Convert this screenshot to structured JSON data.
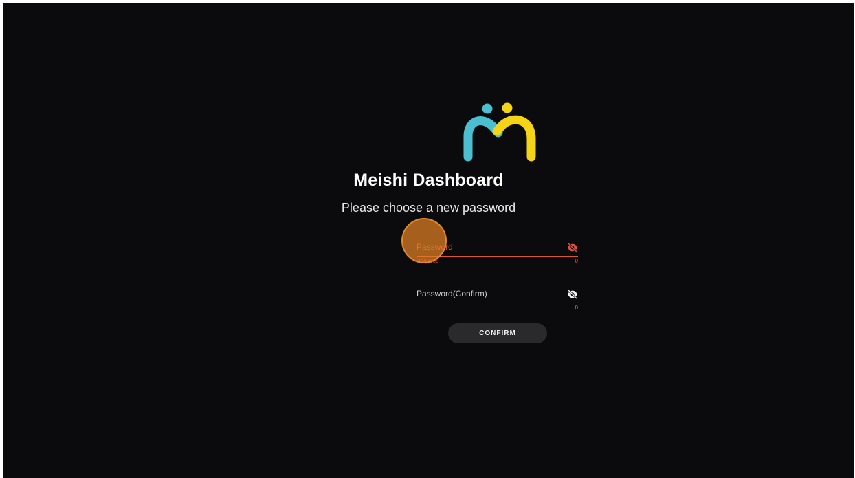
{
  "app": {
    "title": "Meishi Dashboard",
    "subtitle": "Please choose a new password"
  },
  "form": {
    "password": {
      "label": "Password",
      "helper": "Required",
      "counter": "0",
      "state": "error",
      "visibility_icon": "eye-off-icon"
    },
    "password_confirm": {
      "label": "Password(Confirm)",
      "counter": "0",
      "visibility_icon": "eye-off-icon"
    },
    "confirm_label": "CONFIRM"
  },
  "colors": {
    "background": "#0b0b0d",
    "error": "#e0523f",
    "logo_cyan": "#4bbfcf",
    "logo_yellow": "#f5d316",
    "button": "#2a2a2c",
    "touch_indicator": "#e28024"
  }
}
